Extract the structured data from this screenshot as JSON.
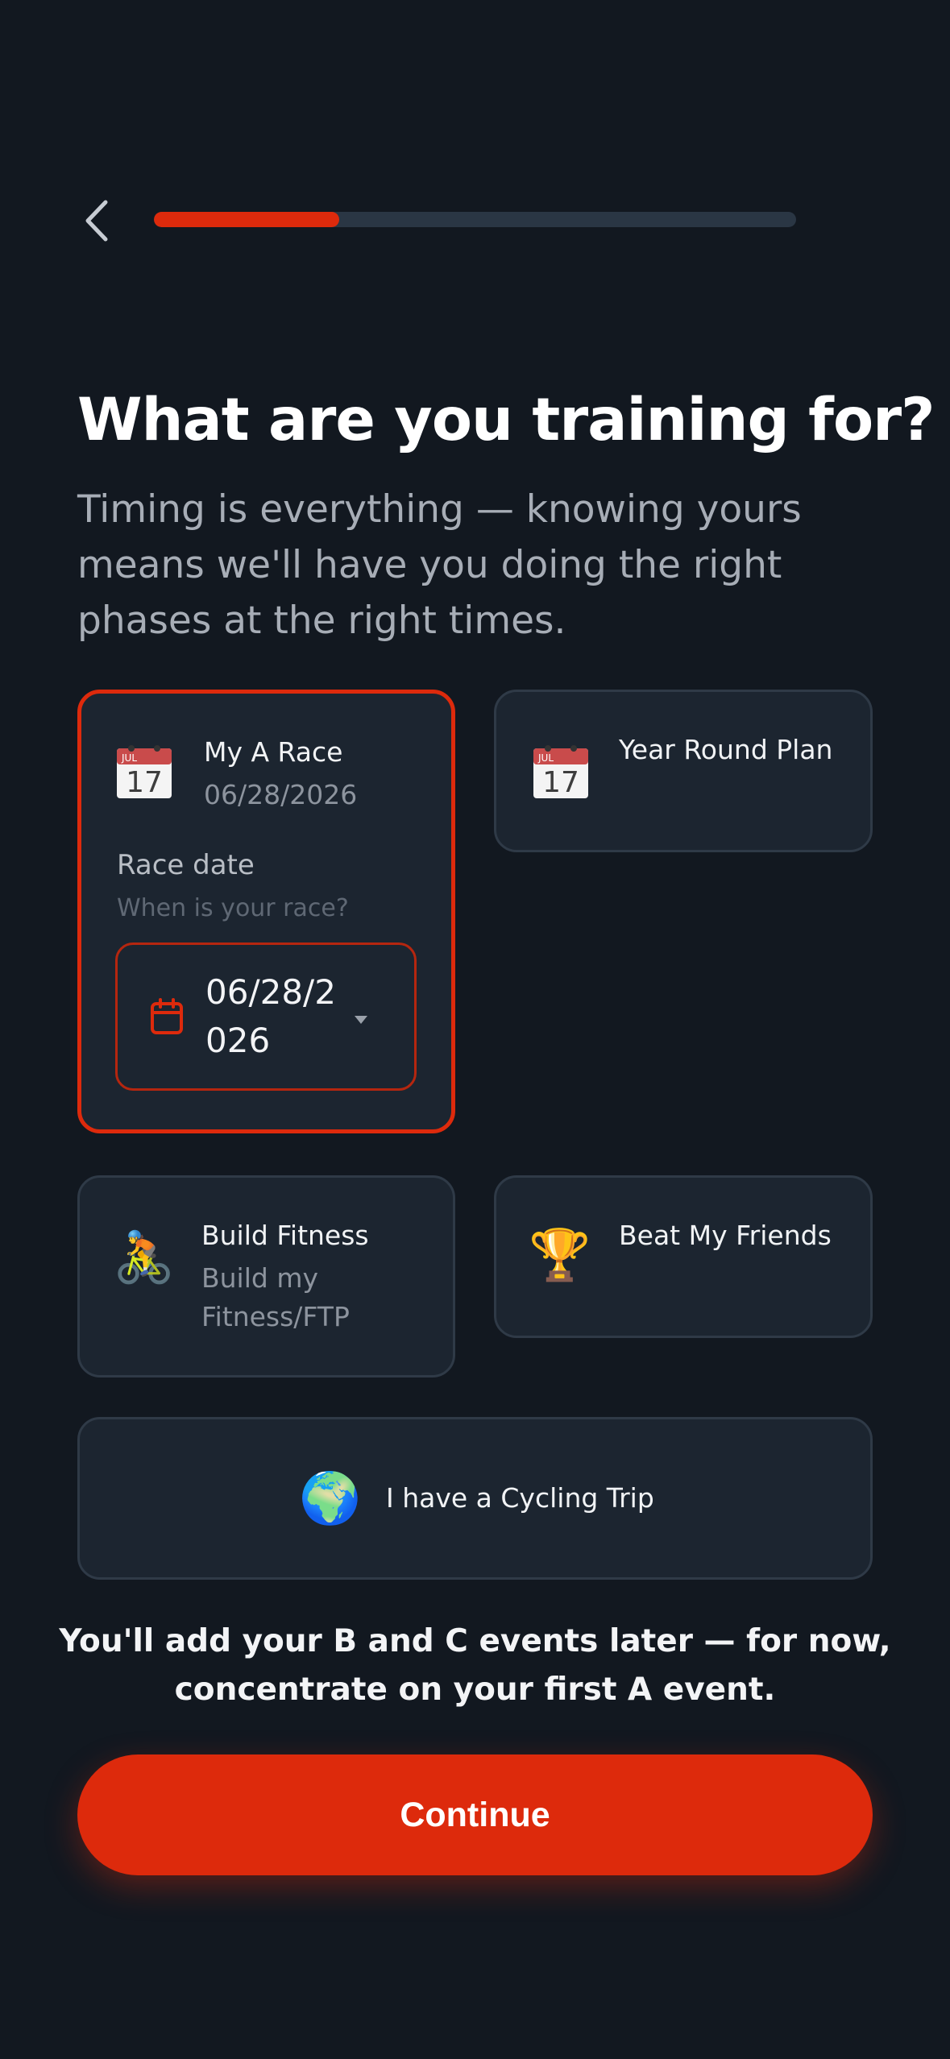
{
  "header": {
    "progress_percent": 28.8
  },
  "title": "What are you training for?",
  "subtitle": "Timing is everything — knowing yours means we'll have you doing the right phases at the right times.",
  "options": {
    "a_race": {
      "title": "My A Race",
      "date_value": "06/28/2026",
      "race_date_label": "Race date",
      "race_date_hint": "When is your race?",
      "field_value_line1": "06/28/2",
      "field_value_line2": "026",
      "icon": "calendar-icon",
      "calendar_month": "JUL",
      "calendar_day": "17",
      "selected": true
    },
    "year_round": {
      "title": "Year Round Plan",
      "icon": "calendar-icon",
      "calendar_month": "JUL",
      "calendar_day": "17"
    },
    "build_fitness": {
      "title": "Build Fitness",
      "subtitle_line1": "Build my",
      "subtitle_line2": "Fitness/FTP",
      "icon": "cyclist-icon",
      "emoji": "🚴"
    },
    "beat_friends": {
      "title": "Beat My Friends",
      "icon": "trophy-icon",
      "emoji": "🏆"
    },
    "cycling_trip": {
      "title": "I have a Cycling Trip",
      "icon": "globe-icon",
      "emoji": "🌍"
    }
  },
  "footnote": "You'll add your B and C events later — for now, concentrate on your first A event.",
  "continue_label": "Continue",
  "colors": {
    "background": "#121820",
    "card": "#1c2530",
    "accent": "#dd2a0c",
    "progress_track": "#2a3644"
  }
}
